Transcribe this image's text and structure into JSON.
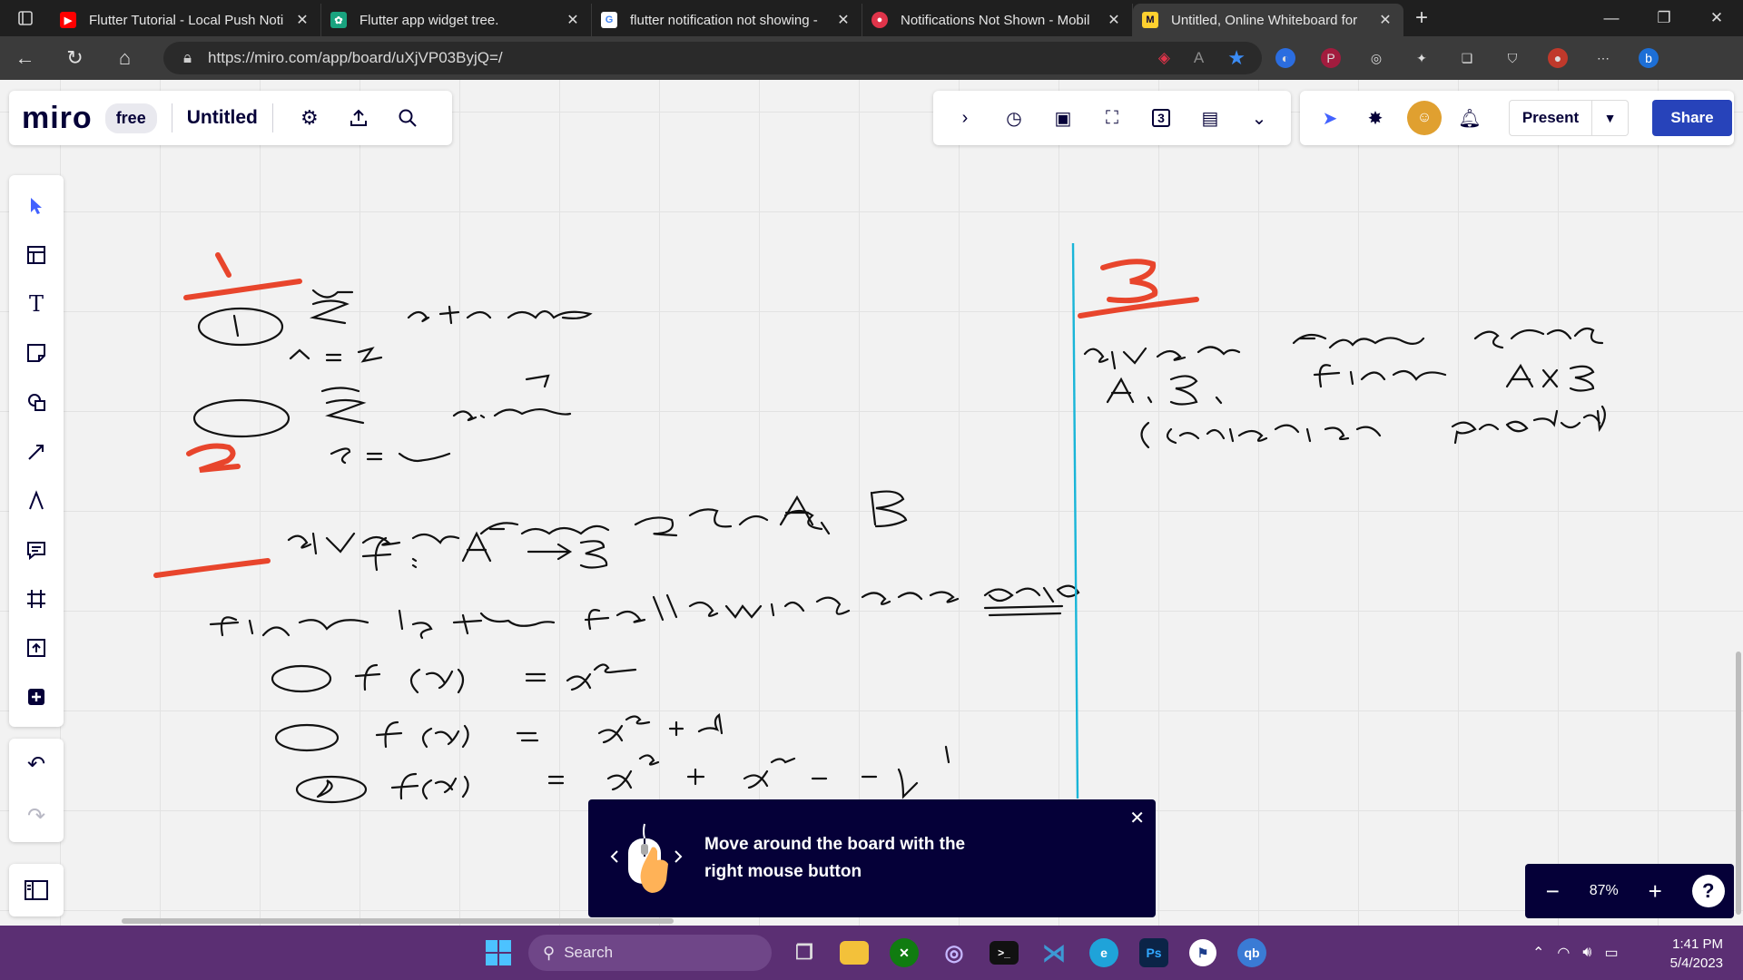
{
  "browser": {
    "tabs": [
      {
        "title": "Flutter Tutorial - Local Push Noti",
        "favicon": "youtube-icon",
        "color": "#ff0000"
      },
      {
        "title": "Flutter app widget tree.",
        "favicon": "chatgpt-icon",
        "color": "#19a37f"
      },
      {
        "title": "flutter notification not showing -",
        "favicon": "google-icon",
        "color": "#4285f4"
      },
      {
        "title": "Notifications Not Shown - Mobil",
        "favicon": "bug-icon",
        "color": "#e0344a"
      },
      {
        "title": "Untitled, Online Whiteboard for",
        "favicon": "miro-icon",
        "color": "#ffd02f",
        "active": true
      }
    ],
    "url": "https://miro.com/app/board/uXjVP03ByjQ=/"
  },
  "miro": {
    "logo": "miro",
    "plan": "free",
    "board_title": "Untitled",
    "present_label": "Present",
    "share_label": "Share",
    "toolbar_counter": "3",
    "zoom": "87%",
    "help": "?",
    "hint_text": "Move around the board with the right mouse button"
  },
  "taskbar": {
    "search_placeholder": "Search",
    "time": "1:41 PM",
    "date": "5/4/2023"
  },
  "colors": {
    "miro_navy": "#050038",
    "miro_blue": "#4262ff",
    "share_blue": "#2743ba",
    "ink_red": "#e8452c",
    "divider_cyan": "#19b5d8",
    "taskbar": "#5b2f73"
  }
}
